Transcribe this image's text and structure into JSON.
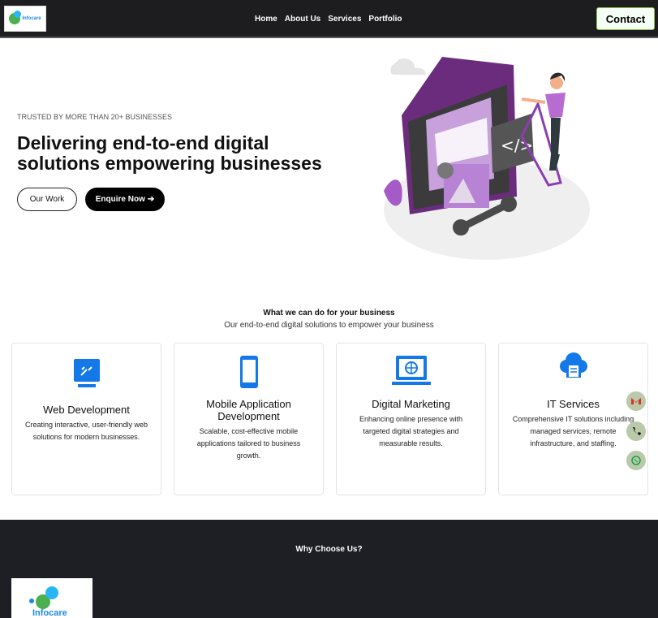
{
  "header": {
    "logo_text": "Infocare",
    "menu": [
      "Home",
      "About Us",
      "Services",
      "Portfolio"
    ],
    "contact_label": "Contact"
  },
  "hero": {
    "trust_text": "TRUSTED BY MORE THAN 20+ BUSINESSES",
    "title": "Delivering end-to-end digital solutions empowering businesses",
    "our_work_label": "Our Work",
    "enquire_label": "Enquire Now",
    "enquire_icon": "arrow-right-icon"
  },
  "services": {
    "title": "What we can do for your business",
    "subtitle": "Our end-to-end digital solutions to empower your business",
    "cards": [
      {
        "title": "Web Development",
        "text": "Creating interactive, user-friendly web solutions for modern businesses.",
        "icon": "web-development-icon"
      },
      {
        "title": "Mobile Application Development",
        "text": "Scalable, cost-effective mobile applications tailored to business growth.",
        "icon": "mobile-app-icon"
      },
      {
        "title": "Digital Marketing",
        "text": "Enhancing online presence with targeted digital strategies and measurable results.",
        "icon": "digital-marketing-icon"
      },
      {
        "title": "IT Services",
        "text": "Comprehensive IT solutions including managed services, remote infrastructure, and staffing.",
        "icon": "cloud-it-icon"
      }
    ]
  },
  "floating": [
    "gmail-icon",
    "phone-icon",
    "whatsapp-icon"
  ],
  "why": {
    "title": "Why Choose Us?"
  },
  "footer": {
    "logo_text": "Infocare"
  },
  "colors": {
    "dark": "#1d1d1f",
    "accent": "#1479e8",
    "purple": "#9c4fc2"
  }
}
